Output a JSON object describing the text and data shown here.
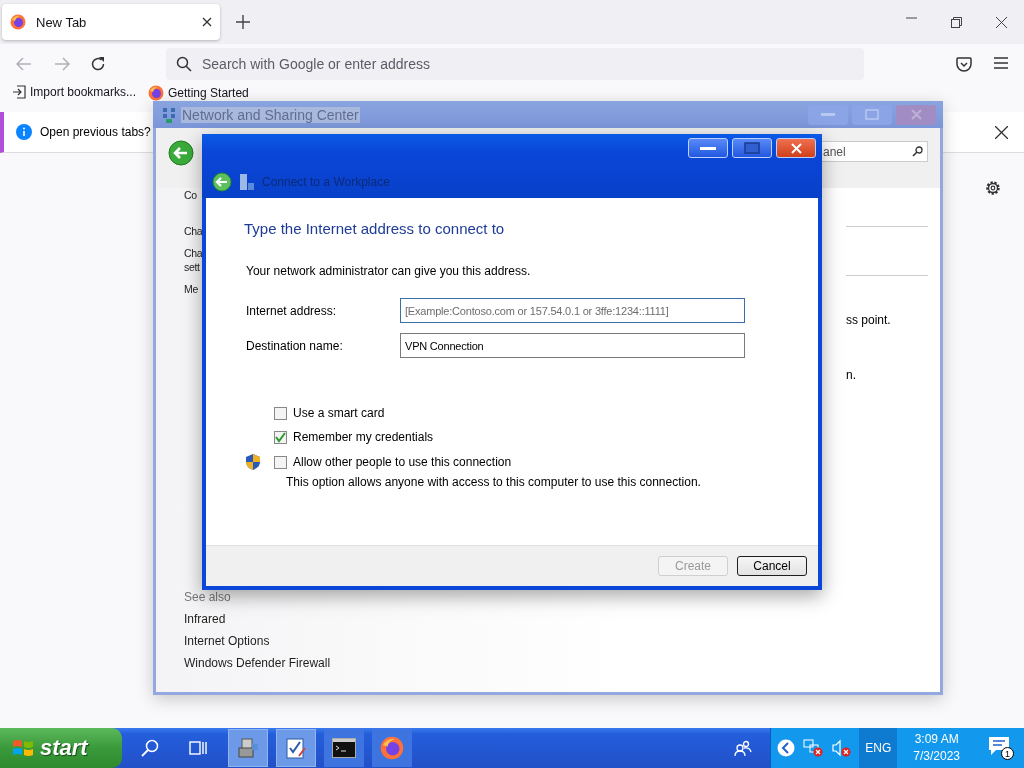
{
  "browser": {
    "tabs": [
      {
        "title": "New Tab",
        "selected": true
      }
    ],
    "address_bar": {
      "placeholder": "Search with Google or enter address"
    },
    "bookmarks": [
      {
        "label": "Import bookmarks...",
        "kind": "import"
      },
      {
        "label": "Getting Started",
        "kind": "firefox"
      }
    ],
    "notification": {
      "text": "Open previous tabs?"
    }
  },
  "background_window": {
    "title": "Network and Sharing Center",
    "search": {
      "placeholder": "anel"
    },
    "left_pane": [
      {
        "lines": [
          "Co"
        ]
      },
      {
        "lines": [
          "Cha"
        ]
      },
      {
        "lines": [
          "Cha",
          "sett"
        ]
      },
      {
        "lines": [
          "Me"
        ]
      }
    ],
    "right_pane": [
      "ss point.",
      "n."
    ],
    "see_also": {
      "heading": "See also",
      "links": [
        "Infrared",
        "Internet Options",
        "Windows Defender Firewall"
      ]
    }
  },
  "dialog": {
    "title": "Connect to a Workplace",
    "heading": "Type the Internet address to connect to",
    "intro": "Your network administrator can give you this address.",
    "fields": [
      {
        "label": "Internet address:",
        "placeholder": "[Example:Contoso.com or 157.54.0.1 or 3ffe:1234::1111]",
        "focused": true
      },
      {
        "label": "Destination name:",
        "value": "VPN Connection",
        "focused": false
      }
    ],
    "options": [
      {
        "label": "Use a smart card",
        "checked": false,
        "shield": false
      },
      {
        "label": "Remember my credentials",
        "checked": true,
        "shield": false
      },
      {
        "label": "Allow other people to use this connection",
        "checked": false,
        "shield": true,
        "note": "This option allows anyone with access to this computer to use this connection."
      }
    ],
    "buttons": [
      {
        "label": "Create",
        "disabled": true
      },
      {
        "label": "Cancel",
        "disabled": false
      }
    ]
  },
  "taskbar": {
    "start": "start",
    "apps": [
      {
        "kind": "network",
        "active": true
      },
      {
        "kind": "wizard",
        "active": true
      },
      {
        "kind": "terminal",
        "active": false
      },
      {
        "kind": "firefox",
        "active": false
      }
    ],
    "language": "ENG",
    "time": "3:09 AM",
    "date": "7/3/2023",
    "notifications": "1"
  }
}
